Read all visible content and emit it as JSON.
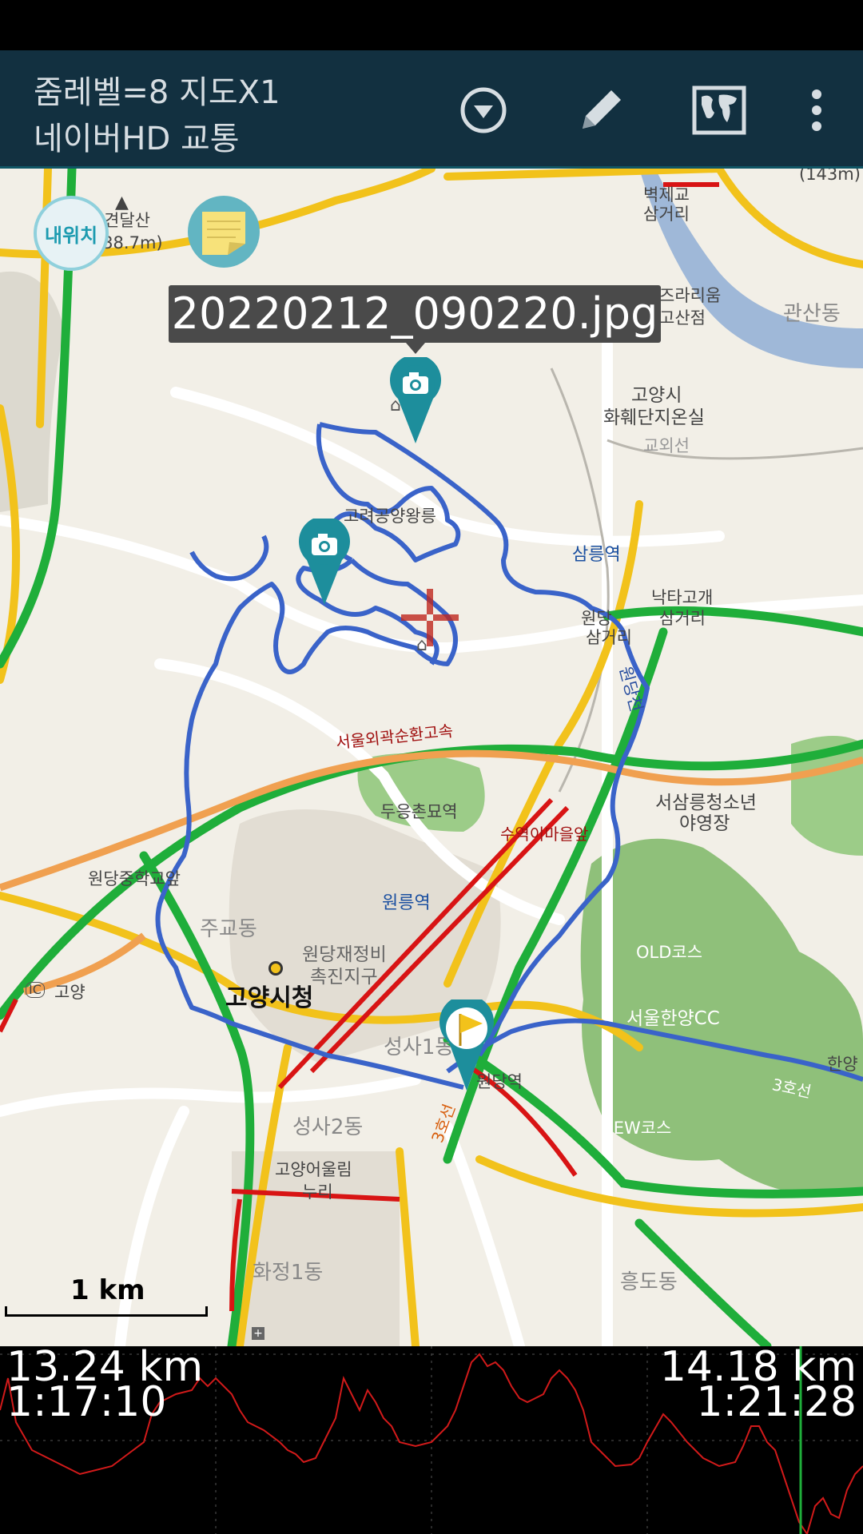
{
  "header": {
    "zoom_info": "줌레벨=8 지도X1",
    "map_source": "네이버HD 교통"
  },
  "toolbar": {
    "dropdown_icon": "chevron-circle-down-icon",
    "edit_icon": "pencil-icon",
    "map_icon": "world-map-icon",
    "menu_icon": "more-vert-icon"
  },
  "map": {
    "my_location_label": "내위치",
    "photo_tooltip": "20220212_090220.jpg",
    "scale_label": "1 km",
    "places": {
      "gyeondalsan": "견달산",
      "gyeondalsan_elev": "(38.7m)",
      "top_elev": "(143m)",
      "byeokje_1": "벽제교",
      "byeokje_2": "삼거리",
      "sunrise_1": "즈라리움",
      "sunrise_2": "고산점",
      "gwansan": "관산동",
      "goyang_hwajang_1": "고양시",
      "goyang_hwajang_2": "화훼단지온실",
      "goeoiseon": "교외선",
      "gorye_royal_tomb": "고려공양왕릉",
      "samneung_station": "삼릉역",
      "naktagogae_1": "낙타고개",
      "naktagogae_2": "삼거리",
      "wondang_junction_1": "원당",
      "wondang_junction_2": "삼거리",
      "wondangcheon": "원당천",
      "ring_expressway": "서울외곽순환고속",
      "dueungchon_station": "두응촌묘역",
      "suyeok_ima": "수역이마을앞",
      "seosamneung_1": "서삼릉청소년",
      "seosamneung_2": "야영장",
      "wondang_mid_school": "원당중학교앞",
      "wonneung_station": "원릉역",
      "jugyo": "주교동",
      "wondang_redevelop_1": "원당재정비",
      "wondang_redevelop_2": "촉진지구",
      "old_course": "OLD코스",
      "goyang_city_hall": "고양시청",
      "seoul_hanyang_cc": "서울한양CC",
      "ic_goyang": "고양",
      "ic": "IC",
      "seongsa1": "성사1동",
      "wondang_station": "원당역",
      "hanyang": "한양",
      "line3": "3호선",
      "new_course": "NEW코스",
      "seongsa2": "성사2동",
      "goyang_eoullim_1": "고양어울림",
      "goyang_eoullim_2": "누리",
      "hwajeong1": "화정1동",
      "heungdo": "흥도동"
    }
  },
  "profile": {
    "left_distance": "13.24 km",
    "left_time": "1:17:10",
    "right_distance": "14.18 km",
    "right_time": "1:21:28"
  },
  "colors": {
    "app_bar": "#123040",
    "track": "#3a63c9",
    "highway_green": "#1fae3a",
    "road_yellow": "#f2c21b",
    "traffic_red": "#d81414",
    "forest": "#8fc07a",
    "river": "#9fb8d8",
    "marker_teal": "#1d8e9c",
    "elevation_line": "#d11a1a"
  }
}
